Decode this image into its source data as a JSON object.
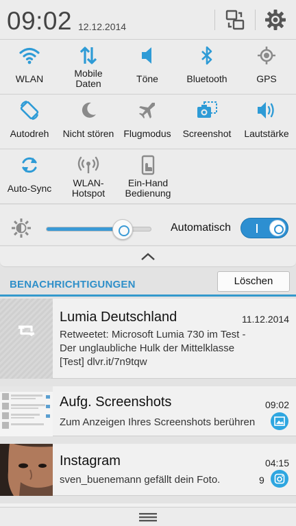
{
  "status": {
    "time": "09:02",
    "date": "12.12.2014"
  },
  "toggles": [
    [
      {
        "label": "WLAN",
        "icon": "wifi-icon",
        "active": true
      },
      {
        "label": "Mobile\nDaten",
        "icon": "mobile-data-icon",
        "active": true
      },
      {
        "label": "Töne",
        "icon": "sound-icon",
        "active": true
      },
      {
        "label": "Bluetooth",
        "icon": "bluetooth-icon",
        "active": true
      },
      {
        "label": "GPS",
        "icon": "gps-icon",
        "active": false
      }
    ],
    [
      {
        "label": "Autodreh",
        "icon": "auto-rotate-icon",
        "active": true
      },
      {
        "label": "Nicht stören",
        "icon": "do-not-disturb-icon",
        "active": false
      },
      {
        "label": "Flugmodus",
        "icon": "airplane-icon",
        "active": false
      },
      {
        "label": "Screenshot",
        "icon": "screenshot-icon",
        "active": true
      },
      {
        "label": "Lautstärke",
        "icon": "volume-icon",
        "active": true
      }
    ],
    [
      {
        "label": "Auto-Sync",
        "icon": "sync-icon",
        "active": true
      },
      {
        "label": "WLAN-\nHotspot",
        "icon": "hotspot-icon",
        "active": false
      },
      {
        "label": "Ein-Hand\nBedienung",
        "icon": "one-hand-icon",
        "active": false
      }
    ]
  ],
  "brightness": {
    "level": 0.73,
    "auto_label": "Automatisch",
    "auto_on": true
  },
  "notifications_header": {
    "title": "BENACHRICHTIGUNGEN",
    "clear_label": "Löschen"
  },
  "notifications": [
    {
      "app": "Lumia Deutschland",
      "time": "11.12.2014",
      "lines": [
        "Retweetet: Microsoft Lumia 730 im Test -",
        "Der unglaubliche Hulk der Mittelklasse",
        "[Test] dlvr.it/7n9tqw"
      ]
    },
    {
      "app": "Aufg. Screenshots",
      "time": "09:02",
      "lines": [
        "Zum Anzeigen Ihres Screenshots berühren"
      ]
    },
    {
      "app": "Instagram",
      "time": "04:15",
      "lines": [
        "sven_buenemann gefällt dein Foto."
      ],
      "count": "9"
    }
  ],
  "colors": {
    "accent": "#3399CC",
    "active_icon": "#2E9BD6",
    "inactive_icon": "#8A8A8A"
  }
}
